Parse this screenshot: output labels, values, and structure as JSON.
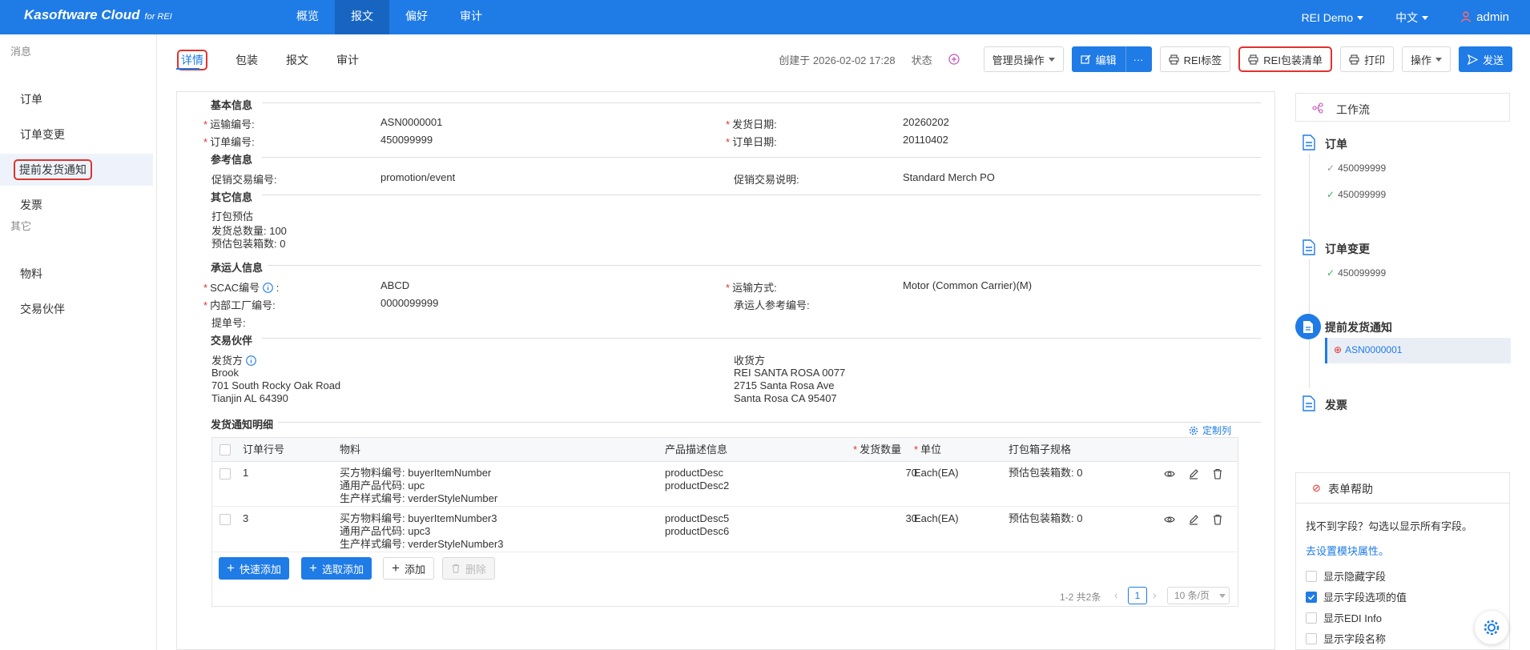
{
  "brand": {
    "name": "Kasoftware Cloud",
    "sub": "for REI"
  },
  "topnav": [
    {
      "label": "概览"
    },
    {
      "label": "报文"
    },
    {
      "label": "偏好"
    },
    {
      "label": "审计"
    }
  ],
  "topright": {
    "tenant": "REI Demo",
    "lang": "中文",
    "user": "admin"
  },
  "sidebar": {
    "group1": "消息",
    "items1": [
      "订单",
      "订单变更",
      "提前发货通知",
      "发票"
    ],
    "group2": "其它",
    "items2": [
      "物料",
      "交易伙伴"
    ]
  },
  "tabs": [
    "详情",
    "包装",
    "报文",
    "审计"
  ],
  "toolbar": {
    "created": "创建于 2026-02-02 17:28",
    "status": "状态",
    "admin_ops": "管理员操作",
    "edit": "编辑",
    "more": "···",
    "rei_label": "REI标签",
    "rei_pack": "REI包装清单",
    "print": "打印",
    "ops": "操作",
    "send": "发送"
  },
  "form": {
    "basic": {
      "title": "基本信息",
      "ship_no_label": "运输编号:",
      "ship_no": "ASN0000001",
      "ship_date_label": "发货日期:",
      "ship_date": "20260202",
      "order_no_label": "订单编号:",
      "order_no": "450099999",
      "order_date_label": "订单日期:",
      "order_date": "20110402"
    },
    "ref": {
      "title": "参考信息",
      "promo_no_label": "促销交易编号:",
      "promo_no": "promotion/event",
      "promo_desc_label": "促销交易说明:",
      "promo_desc": "Standard Merch PO"
    },
    "other": {
      "title": "其它信息",
      "l1": "打包预估",
      "l2": "发货总数量: 100",
      "l3": "预估包装箱数: 0"
    },
    "carrier": {
      "title": "承运人信息",
      "scac_label": "SCAC编号",
      "scac": "ABCD",
      "method_label": "运输方式:",
      "method": "Motor (Common Carrier)(M)",
      "plant_label": "内部工厂编号:",
      "plant": "0000099999",
      "carrier_ref_label": "承运人参考编号:",
      "bol_label": "提单号:"
    },
    "partner": {
      "title": "交易伙伴",
      "shipper_label": "发货方",
      "shipper": [
        "Brook",
        "701 South Rocky Oak Road",
        "Tianjin AL 64390"
      ],
      "receiver_label": "收货方",
      "receiver": [
        "REI SANTA ROSA 0077",
        "2715 Santa Rosa Ave",
        "Santa Rosa CA 95407"
      ]
    },
    "detail": {
      "title": "发货通知明细",
      "customize": "定制列",
      "headers": [
        "订单行号",
        "物料",
        "产品描述信息",
        "发货数量",
        "单位",
        "打包箱子规格"
      ],
      "rows": [
        {
          "line": "1",
          "m1": "买方物料编号: buyerItemNumber",
          "m2": "通用产品代码: upc",
          "m3": "生产样式编号: verderStyleNumber",
          "d1": "productDesc",
          "d2": "productDesc2",
          "qty": "70",
          "unit": "Each(EA)",
          "box": "预估包装箱数: 0"
        },
        {
          "line": "3",
          "m1": "买方物料编号: buyerItemNumber3",
          "m2": "通用产品代码: upc3",
          "m3": "生产样式编号: verderStyleNumber3",
          "d1": "productDesc5",
          "d2": "productDesc6",
          "qty": "30",
          "unit": "Each(EA)",
          "box": "预估包装箱数: 0"
        }
      ],
      "btn_quick": "快速添加",
      "btn_select": "选取添加",
      "btn_add": "添加",
      "btn_delete": "删除",
      "total": "1-2 共2条",
      "page": "1",
      "page_size": "10 条/页"
    }
  },
  "workflow": {
    "title": "工作流",
    "n1": "订单",
    "n1_a": "450099999",
    "n1_b": "450099999",
    "n2": "订单变更",
    "n2_a": "450099999",
    "n3": "提前发货通知",
    "n3_a": "ASN0000001",
    "n4": "发票"
  },
  "help": {
    "title": "表单帮助",
    "text": "找不到字段？勾选以显示所有字段。",
    "link": "去设置模块属性。",
    "opts": [
      "显示隐藏字段",
      "显示字段选项的值",
      "显示EDI Info",
      "显示字段名称"
    ]
  }
}
